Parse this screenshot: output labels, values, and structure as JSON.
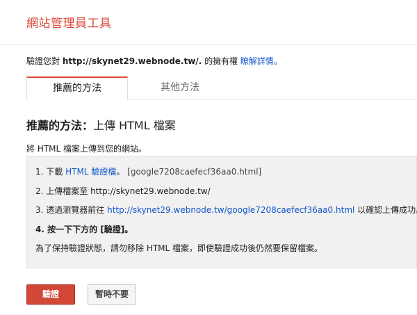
{
  "header": {
    "app_title": "網站管理員工具"
  },
  "verify": {
    "prefix": "驗證您對 ",
    "site": "http://skynet29.webnode.tw/.",
    "suffix": " 的擁有權 ",
    "learn_more": "瞭解詳情。"
  },
  "tabs": [
    {
      "label": "推薦的方法",
      "active": true
    },
    {
      "label": "其他方法",
      "active": false
    }
  ],
  "section": {
    "title_bold": "推薦的方法：",
    "title_rest": "上傳 HTML 檔案"
  },
  "intro": "將 HTML 檔案上傳到您的網站。",
  "steps": {
    "s1_prefix": "1. 下載 ",
    "s1_link": "HTML 驗證檔",
    "s1_mid": "。",
    "s1_file": " [google7208caefecf36aa0.html]",
    "s2": "2. 上傳檔案至 http://skynet29.webnode.tw/",
    "s3_prefix": "3. 透過瀏覽器前往 ",
    "s3_link": "http://skynet29.webnode.tw/google7208caefecf36aa0.html",
    "s3_suffix": " 以確認上傳成功。",
    "s4": "4. 按一下下方的 [驗證]。",
    "note": "為了保持驗證狀態，請勿移除 HTML 檔案，即使驗證成功後仍然要保留檔案。"
  },
  "buttons": {
    "verify": "驗證",
    "not_now": "暫時不要"
  },
  "colors": {
    "brand_red": "#dd4b39",
    "link_blue": "#1155cc",
    "button_red": "#d14836"
  }
}
